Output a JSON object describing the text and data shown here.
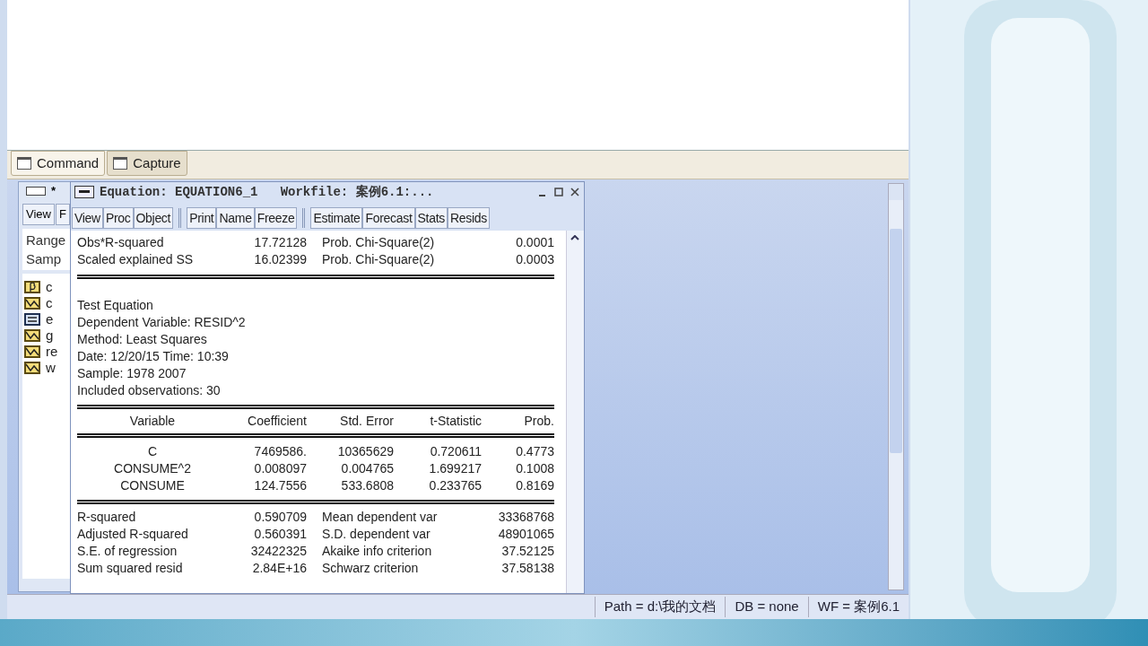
{
  "command_area": {
    "tabs": [
      {
        "label": "Command",
        "selected": true
      },
      {
        "label": "Capture",
        "selected": false
      }
    ]
  },
  "workfile_window": {
    "title": "*",
    "toolbar": [
      "View",
      "F"
    ],
    "info": [
      "Range",
      "Samp"
    ],
    "objects": [
      {
        "kind": "coef",
        "name": "c"
      },
      {
        "kind": "series",
        "name": "c"
      },
      {
        "kind": "equation",
        "name": "e"
      },
      {
        "kind": "series",
        "name": "g"
      },
      {
        "kind": "series",
        "name": "re"
      },
      {
        "kind": "series",
        "name": "w"
      }
    ]
  },
  "equation_window": {
    "title": "Equation: EQUATION6_1   Workfile: 案例6.1:...",
    "toolbar": [
      [
        "View",
        "Proc",
        "Object"
      ],
      [
        "Print",
        "Name",
        "Freeze"
      ],
      [
        "Estimate",
        "Forecast",
        "Stats",
        "Resids"
      ]
    ],
    "test_stats": [
      [
        "Obs*R-squared",
        "17.72128",
        "Prob. Chi-Square(2)",
        "0.0001"
      ],
      [
        "Scaled explained SS",
        "16.02399",
        "Prob. Chi-Square(2)",
        "0.0003"
      ]
    ],
    "header_lines": [
      "Test Equation",
      "Dependent Variable: RESID^2",
      "Method: Least Squares",
      "Date: 12/20/15   Time: 10:39",
      "Sample: 1978 2007",
      "Included observations: 30"
    ],
    "columns": [
      "Variable",
      "Coefficient",
      "Std. Error",
      "t-Statistic",
      "Prob."
    ],
    "rows": [
      [
        "C",
        "7469586.",
        "10365629",
        "0.720611",
        "0.4773"
      ],
      [
        "CONSUME^2",
        "0.008097",
        "0.004765",
        "1.699217",
        "0.1008"
      ],
      [
        "CONSUME",
        "124.7556",
        "533.6808",
        "0.233765",
        "0.8169"
      ]
    ],
    "summary": [
      [
        "R-squared",
        "0.590709",
        "Mean dependent var",
        "33368768"
      ],
      [
        "Adjusted R-squared",
        "0.560391",
        "S.D. dependent var",
        "48901065"
      ],
      [
        "S.E. of regression",
        "32422325",
        "Akaike info criterion",
        "37.52125"
      ],
      [
        "Sum squared resid",
        "2.84E+16",
        "Schwarz criterion",
        "37.58138"
      ]
    ]
  },
  "status_bar": [
    "Path = d:\\我的文档",
    "DB = none",
    "WF = 案例6.1"
  ]
}
